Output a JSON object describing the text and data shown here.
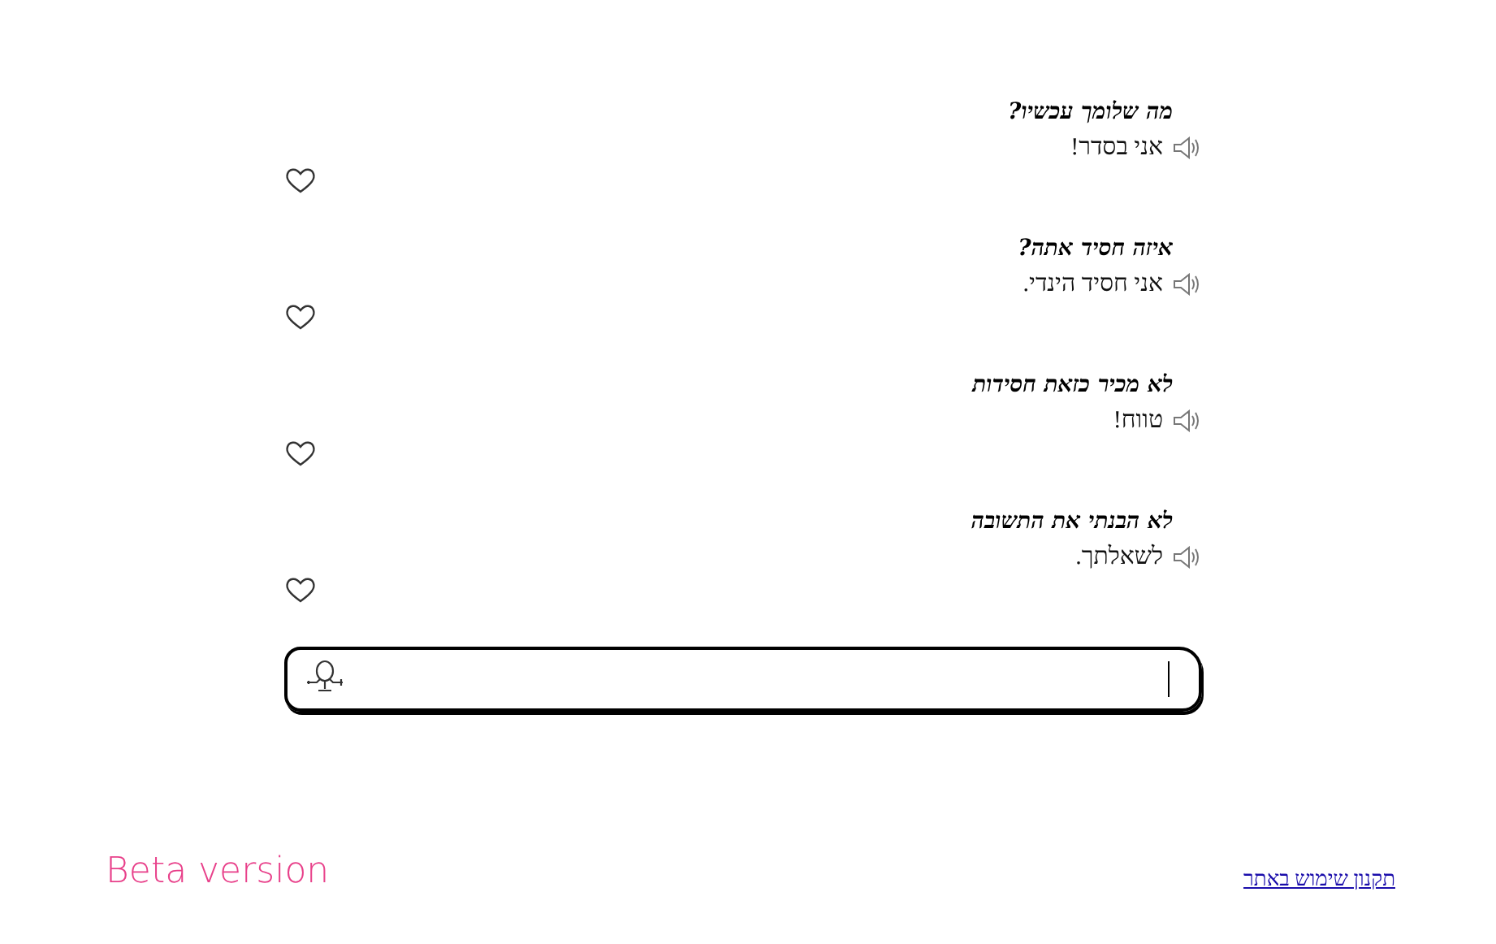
{
  "conversation": [
    {
      "question": "מה שלומך עכשיו?",
      "answer": "אני בסדר!",
      "liked": false
    },
    {
      "question": "איזה חסיד אתה?",
      "answer": "אני חסיד הינדי.",
      "liked": false
    },
    {
      "question": "לא מכיר כזאת חסידות",
      "answer": "טווח!",
      "liked": false
    },
    {
      "question": "לא הבנתי את התשובה",
      "answer": "לשאלתך.",
      "liked": false
    }
  ],
  "footer": {
    "version": "Beta version",
    "terms_link": "תקנון שימוש באתר"
  }
}
